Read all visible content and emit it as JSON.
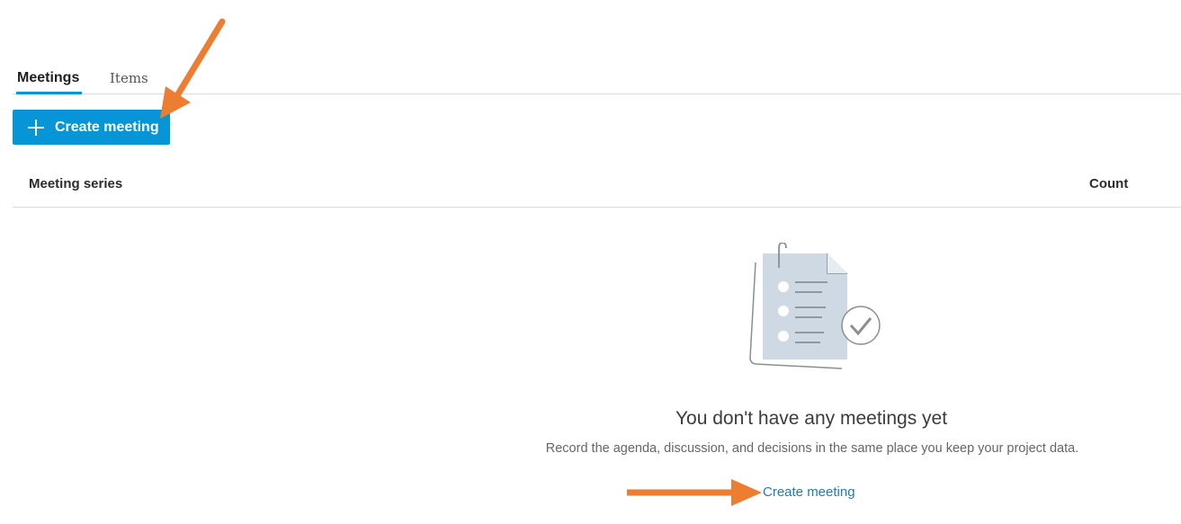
{
  "tabs": [
    {
      "label": "Meetings",
      "active": true
    },
    {
      "label": "Items",
      "active": false
    }
  ],
  "toolbar": {
    "create_button_label": "Create meeting",
    "create_button_icon": "plus-icon"
  },
  "table": {
    "columns": [
      "Meeting series",
      "Count"
    ]
  },
  "empty_state": {
    "illustration": "clipboard-checklist-icon",
    "title": "You don't have any meetings yet",
    "description": "Record the agenda, discussion, and decisions in the same place you keep your project data.",
    "link_label": "Create meeting"
  },
  "annotations": {
    "arrow_color": "#ed7d31"
  },
  "colors": {
    "accent": "#0696d7",
    "link": "#1e7bc0",
    "divider": "#dcdcdc"
  }
}
